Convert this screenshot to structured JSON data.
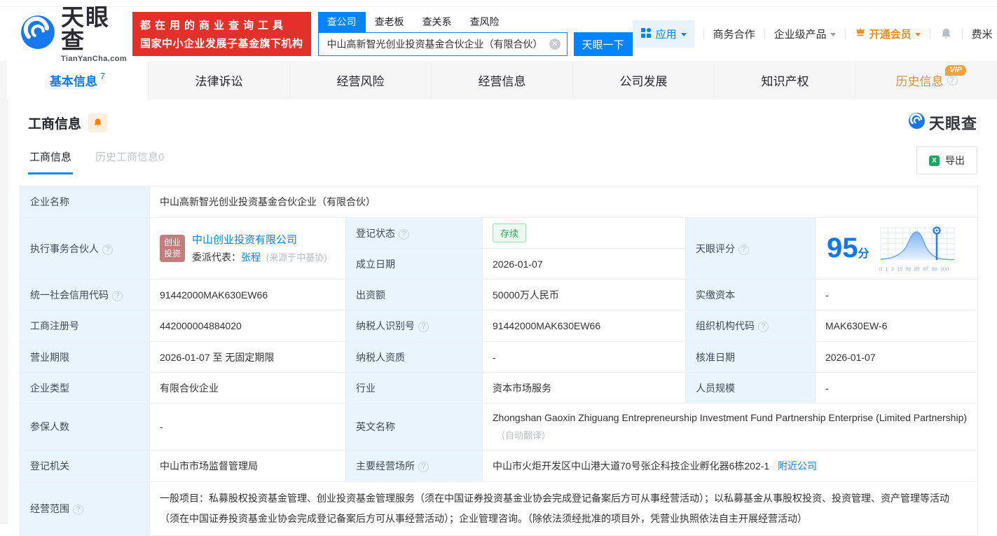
{
  "colors": {
    "brand_blue": "#0084ff",
    "banner_red": "#e3302a",
    "member_orange": "#f08c1f",
    "vip_badge_orange": "#f0a33c",
    "status_green": "#35a35c",
    "label_cell_bg": "#eaf4fd",
    "partner_badge_bg": "#c37d7d",
    "score_blue": "#0b79f7"
  },
  "header": {
    "logo": {
      "brand": "天眼查",
      "domain": "TianYanCha.com"
    },
    "slogan": {
      "line1": "都在用的商业查询工具",
      "line2": "国家中小企业发展子基金旗下机构"
    },
    "search": {
      "tabs": [
        {
          "label": "查公司"
        },
        {
          "label": "查老板"
        },
        {
          "label": "查关系"
        },
        {
          "label": "查风险"
        }
      ],
      "value": "中山高新智光创业投资基金合伙企业（有限合伙）",
      "clear": "✕",
      "button": "天眼一下"
    },
    "menu": {
      "apps": "应用",
      "business_coop": "商务合作",
      "enterprise_product": "企业级产品",
      "open_member": "开通会员",
      "username": "费米"
    }
  },
  "nav": {
    "tabs": [
      {
        "label": "基本信息",
        "count": "7"
      },
      {
        "label": "法律诉讼"
      },
      {
        "label": "经营风险"
      },
      {
        "label": "经营信息"
      },
      {
        "label": "公司发展"
      },
      {
        "label": "知识产权"
      },
      {
        "label": "历史信息",
        "vip": "VIP"
      }
    ]
  },
  "section": {
    "title": "工商信息",
    "watermark": "天眼查",
    "subtabs": [
      {
        "label": "工商信息"
      },
      {
        "label": "历史工商信息0"
      }
    ],
    "export_label": "导出"
  },
  "table": {
    "company_name": {
      "label": "企业名称",
      "value": "中山高新智光创业投资基金合伙企业（有限合伙）"
    },
    "executive_partner": {
      "label": "执行事务合伙人",
      "badge_line1": "创业",
      "badge_line2": "投资",
      "company": "中山创业投资有限公司",
      "rep_label": "委派代表：",
      "rep_name": "张程",
      "rep_source": "(来源于中基协)"
    },
    "reg_status": {
      "label": "登记状态",
      "value": "存续"
    },
    "establish_date": {
      "label": "成立日期",
      "value": "2026-01-07"
    },
    "tyc_score": {
      "label": "天眼评分",
      "score": "95",
      "unit": "分",
      "chart_ticks": [
        "0",
        "1",
        "3",
        "15",
        "50",
        "85",
        "97",
        "99",
        "100"
      ]
    },
    "credit_code": {
      "label": "统一社会信用代码",
      "value": "91442000MAK630EW66"
    },
    "contribution": {
      "label": "出资额",
      "value": "50000万人民币"
    },
    "paid_capital": {
      "label": "实缴资本",
      "value": "-"
    },
    "reg_number": {
      "label": "工商注册号",
      "value": "442000004884020"
    },
    "taxpayer_id": {
      "label": "纳税人识别号",
      "value": "91442000MAK630EW66"
    },
    "org_code": {
      "label": "组织机构代码",
      "value": "MAK630EW-6"
    },
    "business_term": {
      "label": "营业期限",
      "value": "2026-01-07 至 无固定期限"
    },
    "taxpayer_quality": {
      "label": "纳税人资质",
      "value": "-"
    },
    "approval_date": {
      "label": "核准日期",
      "value": "2026-01-07"
    },
    "company_type": {
      "label": "企业类型",
      "value": "有限合伙企业"
    },
    "industry": {
      "label": "行业",
      "value": "资本市场服务"
    },
    "staff_size": {
      "label": "人员规模",
      "value": "-"
    },
    "insured_count": {
      "label": "参保人数",
      "value": "-"
    },
    "english_name": {
      "label": "英文名称",
      "value": "Zhongshan Gaoxin Zhiguang Entrepreneurship Investment Fund Partnership Enterprise (Limited Partnership)",
      "note": "（自动翻译）"
    },
    "reg_authority": {
      "label": "登记机关",
      "value": "中山市市场监督管理局"
    },
    "business_address": {
      "label": "主要经营场所",
      "value": "中山市火炬开发区中山港大道70号张企科技企业孵化器6栋202-1",
      "link": "附近公司"
    },
    "business_scope": {
      "label": "经营范围",
      "value": "一般项目：私募股权投资基金管理、创业投资基金管理服务（须在中国证券投资基金业协会完成登记备案后方可从事经营活动）；以私募基金从事股权投资、投资管理、资产管理等活动（须在中国证券投资基金业协会完成登记备案后方可从事经营活动）；企业管理咨询。（除依法须经批准的项目外，凭营业执照依法自主开展经营活动）"
    }
  }
}
